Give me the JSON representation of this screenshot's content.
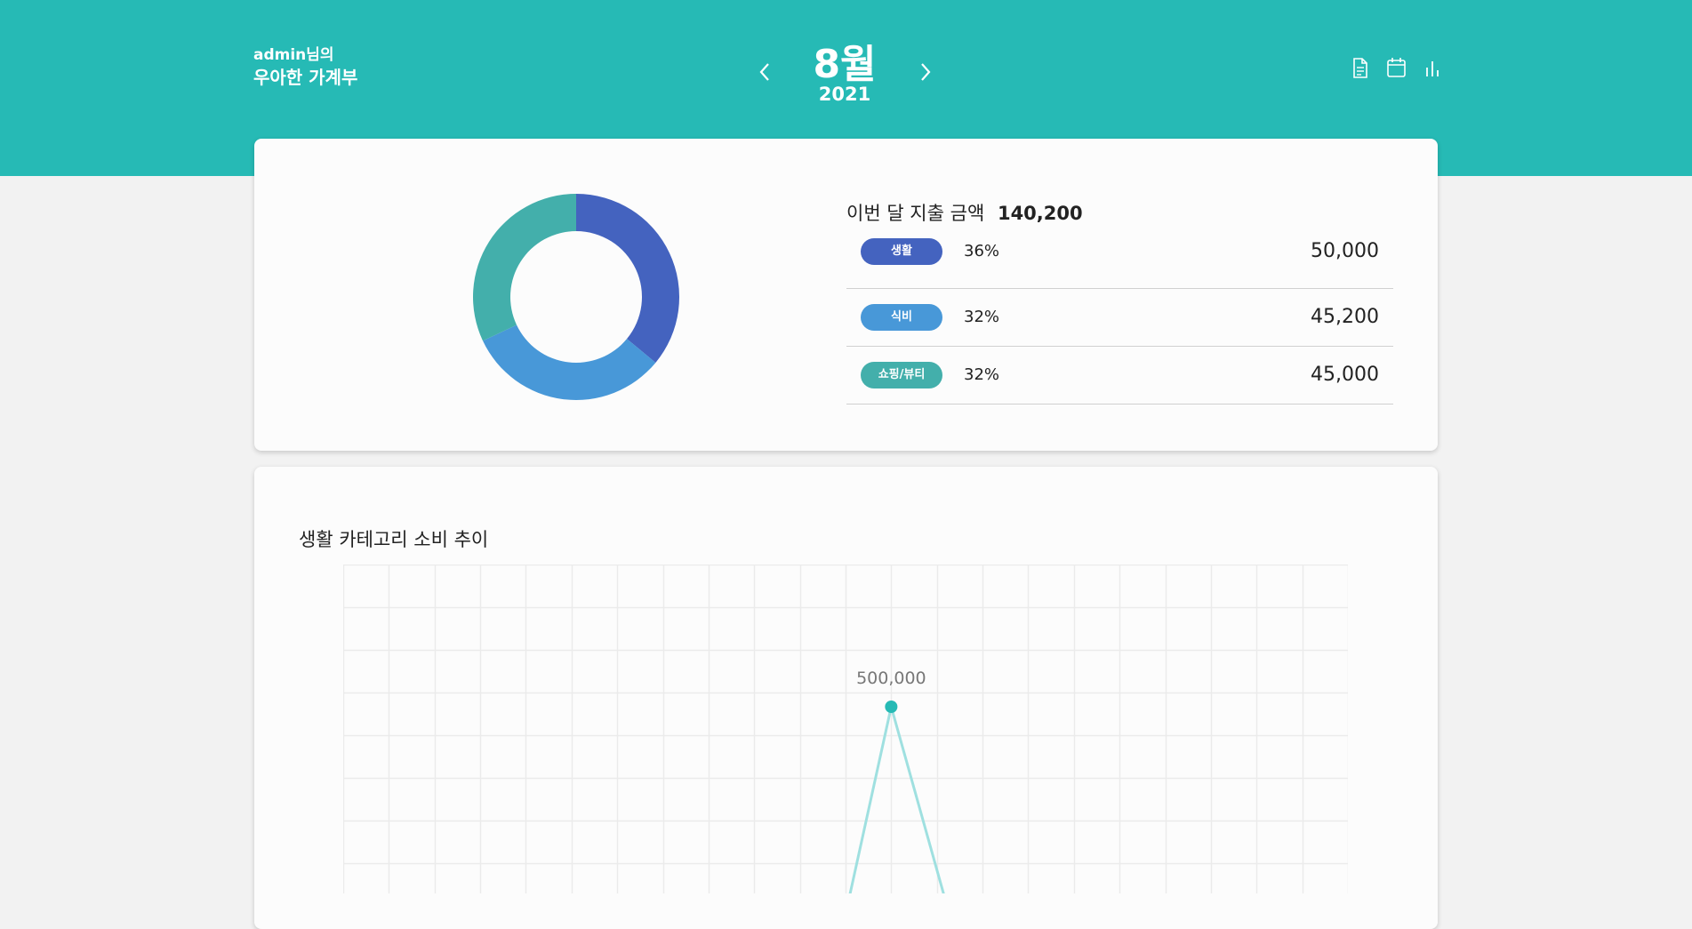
{
  "header": {
    "user_line": "admin님의",
    "app_name": "우아한 가계부",
    "month": "8월",
    "year": "2021",
    "icons": [
      "document-icon",
      "calendar-icon",
      "bar-chart-icon"
    ],
    "color": "#26bab5"
  },
  "summary": {
    "label": "이번 달 지출 금액",
    "total": "140,200",
    "categories": [
      {
        "name": "생활",
        "percent": "36%",
        "amount": "50,000",
        "color": "#4463bf"
      },
      {
        "name": "식비",
        "percent": "32%",
        "amount": "45,200",
        "color": "#4898d8"
      },
      {
        "name": "쇼핑/뷰티",
        "percent": "32%",
        "amount": "45,000",
        "color": "#43afab"
      }
    ]
  },
  "trend": {
    "title": "생활 카테고리 소비 추이",
    "peak_label": "500,000",
    "line_color": "#9fe0e0",
    "point_color": "#26bab5"
  },
  "chart_data": [
    {
      "type": "pie",
      "categories": [
        "생활",
        "식비",
        "쇼핑/뷰티"
      ],
      "values": [
        36,
        32,
        32
      ],
      "donut": true
    },
    {
      "type": "line",
      "title": "생활 카테고리 소비 추이",
      "series": [
        {
          "values": [
            500000
          ]
        }
      ],
      "annotations": [
        "500,000"
      ],
      "grid": true
    }
  ]
}
